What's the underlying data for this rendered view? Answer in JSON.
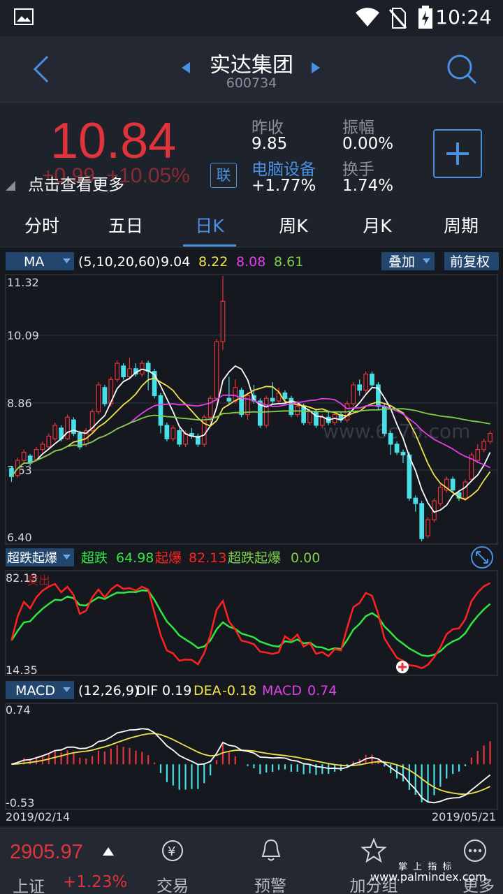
{
  "status": {
    "time": "10:24"
  },
  "header": {
    "name": "实达集团",
    "code": "600734"
  },
  "quote": {
    "price": "10.84",
    "change": "+0.99",
    "change_pct": "+10.05%",
    "tap_more": "点击查看更多",
    "link_badge": "联",
    "prev_close_label": "昨收",
    "prev_close": "9.85",
    "amplitude_label": "振幅",
    "amplitude": "0.00%",
    "sector_label": "电脑设备",
    "sector_change": "+1.77%",
    "turnover_label": "换手",
    "turnover": "1.74%"
  },
  "tabs": [
    "分时",
    "五日",
    "日K",
    "周K",
    "月K",
    "周期"
  ],
  "ma_bar": {
    "dropdown": "MA",
    "params": "(5,10,20,60)",
    "v1": "9.04",
    "v2": "8.22",
    "v3": "8.08",
    "v4": "8.61",
    "overlay": "叠加",
    "adjust": "前复权",
    "c1": "#ffffff",
    "c2": "#f2e34c",
    "c3": "#e040e8",
    "c4": "#7ed04a"
  },
  "price_axis": [
    "11.32",
    "10.09",
    "8.86",
    "7.63",
    "6.40"
  ],
  "ind_bar": {
    "dropdown": "超跌起爆",
    "l1": "超跌",
    "v1": "64.98",
    "l2": "起爆",
    "v2": "82.13",
    "l3": "超跌起爆",
    "v3": "0.00",
    "top": "82.13",
    "bottom": "14.35",
    "marker": "卖出"
  },
  "macd_bar": {
    "dropdown": "MACD",
    "params": "(12,26,9)",
    "dif_label": "DIF",
    "dif": "0.19",
    "dea_label": "DEA",
    "dea": "-0.18",
    "macd_label": "MACD",
    "macd": "0.74",
    "top": "0.74",
    "bottom": "-0.53"
  },
  "dates": {
    "start": "2019/02/14",
    "end": "2019/05/21"
  },
  "watermark": "www.6c7o.com",
  "bottom": {
    "index_value": "2905.97",
    "index_name": "上证",
    "index_change": "+1.23%",
    "nav": [
      "交易",
      "预警",
      "加分组",
      "更多"
    ]
  },
  "corner_watermark": {
    "line1": "掌 上 指 标",
    "line2": "www.palmindex.com"
  },
  "chart_data": {
    "type": "candlestick",
    "ylim": [
      6.4,
      11.32
    ],
    "candles": [
      [
        7.75,
        7.6,
        7.8,
        7.5
      ],
      [
        7.62,
        7.9,
        7.95,
        7.58
      ],
      [
        7.9,
        8.05,
        8.1,
        7.85
      ],
      [
        7.98,
        7.85,
        8.02,
        7.8
      ],
      [
        7.92,
        8.1,
        8.15,
        7.88
      ],
      [
        8.1,
        8.2,
        8.25,
        8.05
      ],
      [
        8.15,
        8.35,
        8.4,
        8.1
      ],
      [
        8.3,
        8.55,
        8.6,
        8.25
      ],
      [
        8.5,
        8.3,
        8.55,
        8.25
      ],
      [
        8.3,
        8.7,
        8.75,
        8.28
      ],
      [
        8.65,
        8.4,
        8.7,
        8.35
      ],
      [
        8.4,
        8.15,
        8.45,
        8.1
      ],
      [
        8.2,
        8.45,
        8.5,
        8.15
      ],
      [
        8.45,
        8.8,
        8.85,
        8.4
      ],
      [
        8.8,
        9.3,
        9.35,
        8.75
      ],
      [
        9.25,
        8.95,
        9.3,
        8.9
      ],
      [
        8.95,
        9.4,
        9.45,
        8.9
      ],
      [
        9.4,
        9.7,
        9.75,
        9.35
      ],
      [
        9.65,
        9.45,
        9.7,
        9.4
      ],
      [
        9.45,
        9.6,
        9.8,
        9.4
      ],
      [
        9.6,
        9.5,
        9.7,
        9.45
      ],
      [
        9.5,
        9.7,
        9.75,
        9.45
      ],
      [
        9.7,
        9.55,
        9.75,
        9.2
      ],
      [
        9.55,
        9.1,
        9.6,
        9.05
      ],
      [
        9.1,
        8.55,
        9.15,
        8.4
      ],
      [
        8.55,
        8.3,
        8.6,
        8.25
      ],
      [
        8.3,
        8.5,
        8.55,
        8.25
      ],
      [
        8.45,
        8.2,
        8.5,
        8.15
      ],
      [
        8.2,
        8.4,
        8.45,
        8.15
      ],
      [
        8.4,
        8.35,
        8.5,
        8.3
      ],
      [
        8.35,
        8.2,
        8.4,
        8.15
      ],
      [
        8.2,
        8.7,
        8.75,
        8.15
      ],
      [
        8.7,
        9.05,
        9.1,
        8.6
      ],
      [
        9.05,
        10.1,
        10.15,
        9.0
      ],
      [
        10.1,
        10.85,
        11.32,
        9.95
      ],
      [
        9.05,
        9.0,
        9.45,
        8.95
      ],
      [
        9.0,
        9.25,
        9.4,
        8.95
      ],
      [
        9.2,
        8.75,
        9.25,
        8.7
      ],
      [
        8.75,
        9.1,
        9.15,
        8.65
      ],
      [
        9.1,
        9.0,
        9.3,
        8.95
      ],
      [
        9.0,
        8.55,
        9.05,
        8.5
      ],
      [
        8.55,
        9.05,
        9.1,
        8.5
      ],
      [
        9.05,
        9.0,
        9.35,
        8.95
      ],
      [
        9.0,
        9.15,
        9.25,
        8.95
      ],
      [
        9.15,
        9.05,
        9.2,
        9.0
      ],
      [
        9.05,
        8.75,
        9.1,
        8.7
      ],
      [
        8.75,
        8.9,
        9.0,
        8.7
      ],
      [
        8.9,
        8.6,
        8.95,
        8.55
      ],
      [
        8.6,
        8.8,
        8.85,
        8.55
      ],
      [
        8.8,
        8.55,
        8.85,
        8.5
      ],
      [
        8.55,
        8.7,
        8.75,
        8.5
      ],
      [
        8.7,
        8.6,
        8.8,
        8.55
      ],
      [
        8.6,
        8.75,
        8.8,
        8.55
      ],
      [
        8.75,
        8.65,
        8.8,
        8.6
      ],
      [
        8.65,
        8.95,
        9.0,
        8.6
      ],
      [
        8.95,
        9.3,
        9.35,
        8.9
      ],
      [
        9.3,
        9.2,
        9.4,
        9.1
      ],
      [
        9.2,
        9.5,
        9.55,
        9.15
      ],
      [
        9.5,
        9.3,
        9.55,
        9.25
      ],
      [
        9.3,
        8.9,
        9.35,
        8.85
      ],
      [
        8.9,
        8.4,
        8.95,
        8.35
      ],
      [
        8.4,
        8.2,
        8.45,
        8.0
      ],
      [
        8.2,
        8.05,
        8.25,
        8.0
      ],
      [
        8.05,
        8.0,
        8.1,
        7.85
      ],
      [
        8.0,
        7.2,
        8.05,
        7.15
      ],
      [
        7.2,
        7.1,
        7.25,
        6.95
      ],
      [
        7.1,
        6.45,
        7.15,
        6.4
      ],
      [
        6.5,
        6.8,
        6.85,
        6.45
      ],
      [
        6.8,
        7.15,
        7.2,
        6.75
      ],
      [
        7.1,
        7.4,
        7.45,
        7.05
      ],
      [
        7.35,
        7.55,
        7.6,
        7.3
      ],
      [
        7.55,
        7.35,
        7.6,
        7.3
      ],
      [
        7.3,
        7.2,
        7.35,
        7.15
      ],
      [
        7.2,
        7.5,
        7.55,
        7.15
      ],
      [
        7.55,
        8.0,
        8.05,
        7.5
      ],
      [
        7.9,
        8.1,
        8.2,
        7.85
      ],
      [
        8.1,
        8.25,
        8.3,
        8.05
      ],
      [
        8.25,
        8.4,
        8.45,
        8.2
      ]
    ]
  }
}
